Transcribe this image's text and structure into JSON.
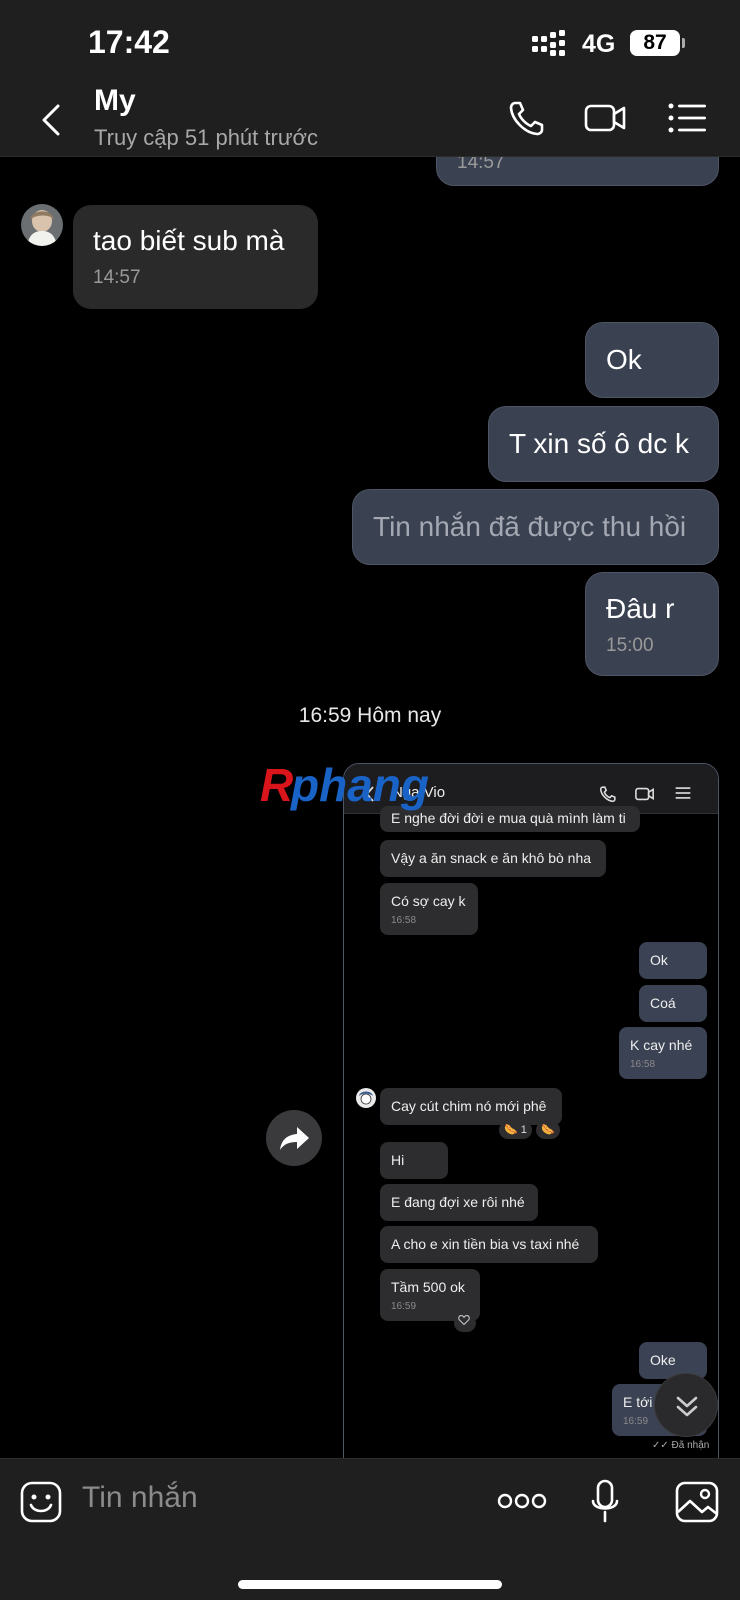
{
  "status_bar": {
    "time": "17:42",
    "network": "4G",
    "battery": "87"
  },
  "header": {
    "contact_name": "My",
    "contact_status": "Truy cập 51 phút trước",
    "icons": [
      "back-icon",
      "phone-icon",
      "video-call-icon",
      "menu-list-icon"
    ]
  },
  "messages": [
    {
      "direction": "out",
      "text": "",
      "time": "14:57"
    },
    {
      "direction": "in",
      "text": "tao biết sub mà",
      "time": "14:57"
    },
    {
      "direction": "out",
      "text": "Ok"
    },
    {
      "direction": "out",
      "text": "T xin số ô dc k"
    },
    {
      "direction": "out",
      "text": "Tin nhắn đã được thu hồi",
      "recalled": true
    },
    {
      "direction": "out",
      "text": "Đâu r",
      "time": "15:00"
    }
  ],
  "day_separator": "16:59 Hôm nay",
  "screenshot": {
    "contact_name": "Nga Vio",
    "messages": [
      {
        "direction": "in",
        "text": "E nghe đời đời e mua quà mình làm ti"
      },
      {
        "direction": "in",
        "text": "Vậy a ăn snack e ăn khô bò nha"
      },
      {
        "direction": "in",
        "text": "Có sợ cay k",
        "time": "16:58"
      },
      {
        "direction": "out",
        "text": "Ok"
      },
      {
        "direction": "out",
        "text": "Coá"
      },
      {
        "direction": "out",
        "text": "K cay nhé",
        "time": "16:58"
      },
      {
        "direction": "in",
        "text": "Cay cút chim nó mới phê",
        "reaction_count": "1"
      },
      {
        "direction": "in",
        "text": "Hi"
      },
      {
        "direction": "in",
        "text": "E đang đợi xe rôi nhé"
      },
      {
        "direction": "in",
        "text": "A cho e xin tiền bia vs taxi nhé"
      },
      {
        "direction": "in",
        "text": "Tầm 500 ok",
        "time": "16:59"
      },
      {
        "direction": "out",
        "text": "Oke"
      },
      {
        "direction": "out",
        "text": "E tới",
        "time": "16:59"
      }
    ],
    "received_label": "Đã nhận"
  },
  "watermark": "Rphang",
  "composer": {
    "placeholder": "Tin nhắn",
    "icons": [
      "emoji-icon",
      "more-icon",
      "microphone-icon",
      "image-icon"
    ]
  },
  "colors": {
    "background": "#000000",
    "bar": "#1f1f1f",
    "incoming_bubble": "#2a2a2b",
    "outgoing_bubble": "#3a4150",
    "watermark_red": "#d9141b",
    "watermark_blue": "#1a63c6"
  }
}
